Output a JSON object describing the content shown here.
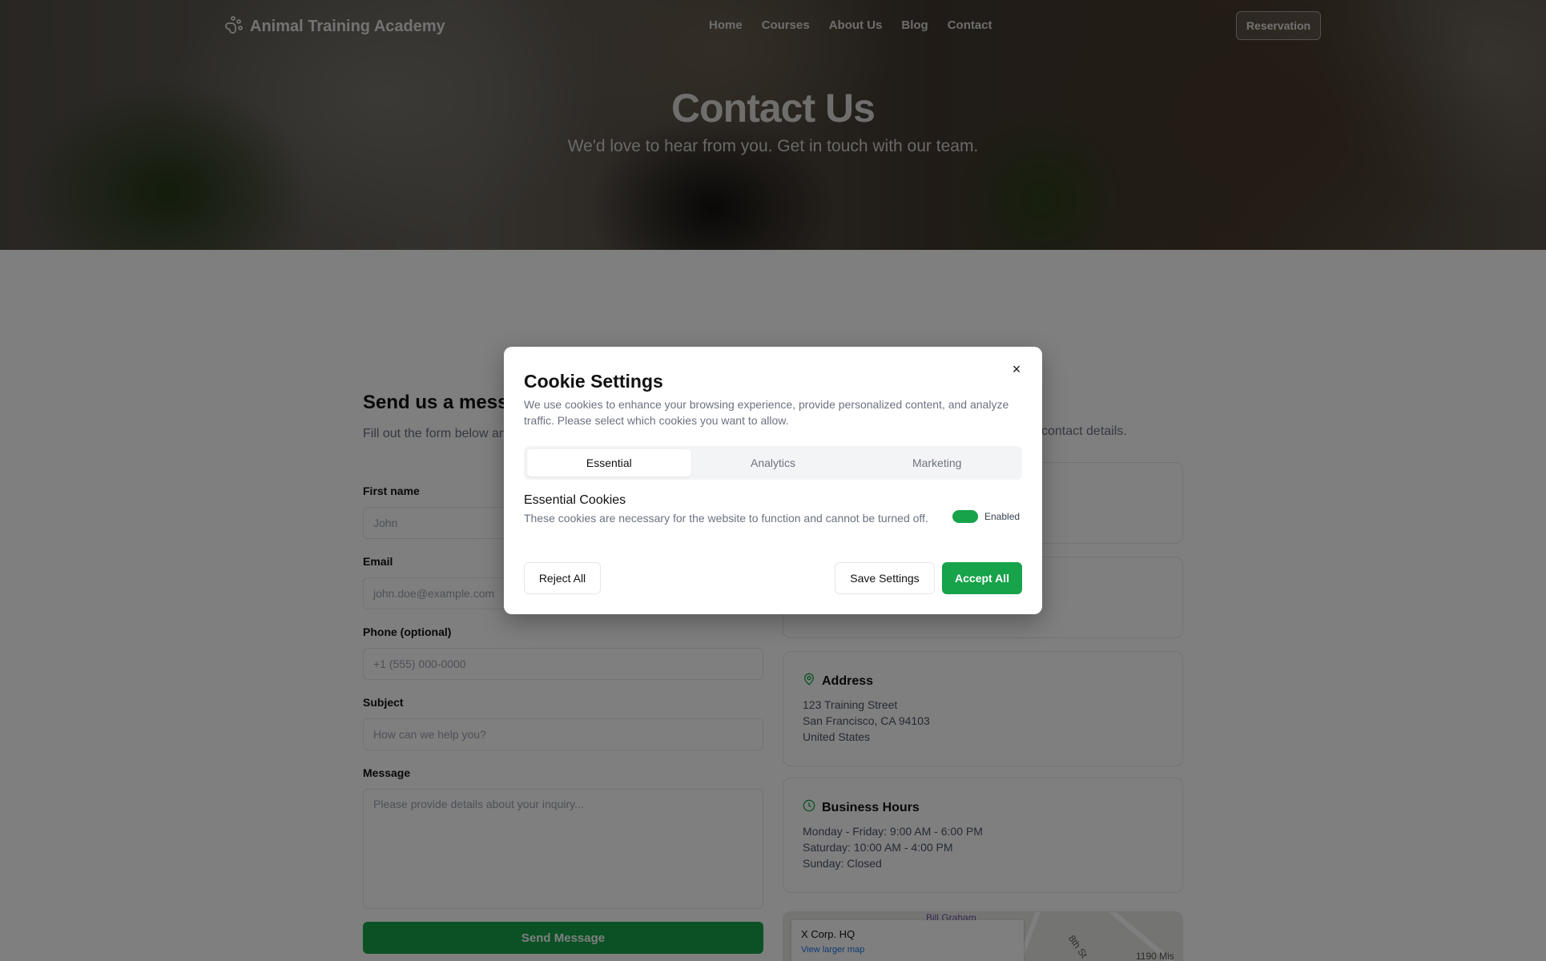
{
  "nav": {
    "brand": "Animal Training Academy",
    "links": [
      "Home",
      "Courses",
      "About Us",
      "Blog",
      "Contact"
    ],
    "reservation": "Reservation"
  },
  "hero": {
    "title": "Contact Us",
    "subtitle": "We'd love to hear from you. Get in touch with our team."
  },
  "form": {
    "title": "Send us a message",
    "description": "Fill out the form below and we'll get back to you as soon as possible.",
    "first_name_label": "First name",
    "first_name_placeholder": "John",
    "email_label": "Email",
    "email_placeholder": "john.doe@example.com",
    "phone_label": "Phone (optional)",
    "phone_placeholder": "+1 (555) 000-0000",
    "subject_label": "Subject",
    "subject_placeholder": "How can we help you?",
    "message_label": "Message",
    "message_placeholder": "Please provide details about your inquiry...",
    "submit": "Send Message"
  },
  "info": {
    "description_visible": "contact details.",
    "address": {
      "title": "Address",
      "lines": [
        "123 Training Street",
        "San Francisco, CA 94103",
        "United States"
      ]
    },
    "hours": {
      "title": "Business Hours",
      "lines": [
        "Monday - Friday: 9:00 AM - 6:00 PM",
        "Saturday: 10:00 AM - 4:00 PM",
        "Sunday: Closed"
      ]
    },
    "map": {
      "place": "X Corp. HQ",
      "link": "View larger map",
      "labels": [
        "Bill Graham",
        "8th St",
        "1190 Mis"
      ]
    }
  },
  "cookie_modal": {
    "title": "Cookie Settings",
    "description": "We use cookies to enhance your browsing experience, provide personalized content, and analyze traffic. Please select which cookies you want to allow.",
    "tabs": [
      "Essential",
      "Analytics",
      "Marketing"
    ],
    "active_tab": "Essential",
    "section_title": "Essential Cookies",
    "section_desc": "These cookies are necessary for the website to function and cannot be turned off.",
    "toggle_label": "Enabled",
    "reject": "Reject All",
    "save": "Save Settings",
    "accept": "Accept All",
    "close": "×"
  },
  "colors": {
    "accent": "#16a34a"
  }
}
